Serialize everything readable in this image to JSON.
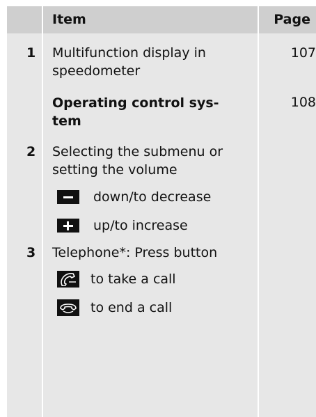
{
  "header": {
    "item": "Item",
    "page": "Page"
  },
  "rows": [
    {
      "num": "1",
      "text": "Multifunction display in speedometer",
      "line1": "Multifunction display in",
      "line2": "speedometer",
      "page": "107"
    },
    {
      "num": "",
      "text": "Operating control system",
      "line1": "Operating control sys-",
      "line2": "tem",
      "page": "108"
    },
    {
      "num": "2",
      "line1": "Selecting the submenu or",
      "line2": "setting the volume",
      "page": ""
    },
    {
      "num": "3",
      "line1": "Telephone*: Press button",
      "page": ""
    }
  ],
  "sub_items": [
    {
      "icon": "minus-button-icon",
      "label": "down/to decrease"
    },
    {
      "icon": "plus-button-icon",
      "label": "up/to increase"
    },
    {
      "icon": "phone-answer-icon",
      "label": "to take a call"
    },
    {
      "icon": "phone-hangup-icon",
      "label": "to end a call"
    }
  ],
  "colors": {
    "header_bg": "#cfcfcf",
    "body_bg": "#e7e7e7",
    "divider": "#ffffff",
    "key_bg": "#111111"
  }
}
